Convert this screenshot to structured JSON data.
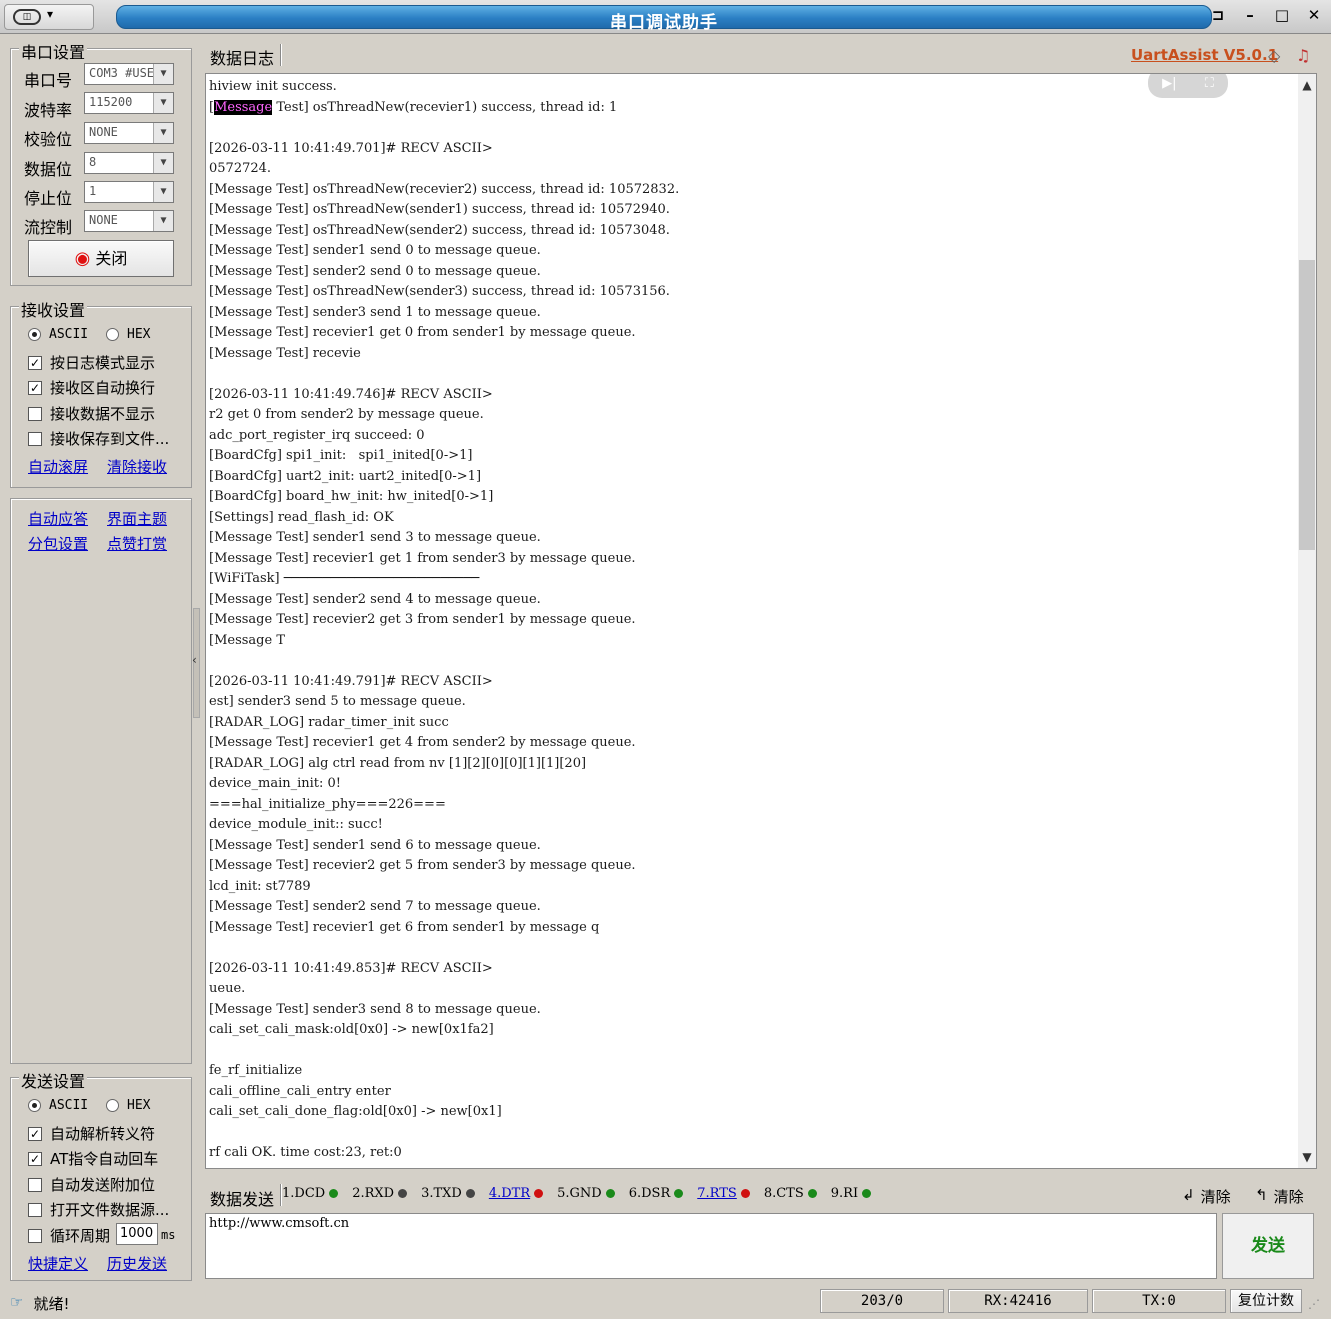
{
  "window": {
    "title": "串口调试助手"
  },
  "serial": {
    "title": "串口设置",
    "fields": [
      {
        "label": "串口号",
        "value": "COM3 #USE"
      },
      {
        "label": "波特率",
        "value": "115200"
      },
      {
        "label": "校验位",
        "value": "NONE"
      },
      {
        "label": "数据位",
        "value": "8"
      },
      {
        "label": "停止位",
        "value": "1"
      },
      {
        "label": "流控制",
        "value": "NONE"
      }
    ],
    "toggle_label": "关闭"
  },
  "recv_settings": {
    "title": "接收设置",
    "ascii": "ASCII",
    "hex": "HEX",
    "options": [
      {
        "label": "按日志模式显示",
        "checked": true
      },
      {
        "label": "接收区自动换行",
        "checked": true
      },
      {
        "label": "接收数据不显示",
        "checked": false
      },
      {
        "label": "接收保存到文件...",
        "checked": false
      }
    ],
    "link_autoscroll": "自动滚屏",
    "link_clear": "清除接收"
  },
  "misc_links": {
    "auto_reply": "自动应答",
    "theme": "界面主题",
    "packet": "分包设置",
    "reward": "点赞打赏"
  },
  "send_settings": {
    "title": "发送设置",
    "ascii": "ASCII",
    "hex": "HEX",
    "options": [
      {
        "label": "自动解析转义符",
        "checked": true
      },
      {
        "label": "AT指令自动回车",
        "checked": true
      },
      {
        "label": "自动发送附加位",
        "checked": false
      },
      {
        "label": "打开文件数据源...",
        "checked": false
      }
    ],
    "loop_label": "循环周期",
    "loop_value": "1000",
    "loop_unit": "ms",
    "link_shortcut": "快捷定义",
    "link_history": "历史发送"
  },
  "log": {
    "tab": "数据日志",
    "brand": "UartAssist V5.0.1",
    "lines": [
      "hiview init success.",
      "[Message Test] osThreadNew(recevier1) success, thread id: 1",
      "",
      "[2026-03-11 10:41:49.701]# RECV ASCII>",
      "0572724.",
      "[Message Test] osThreadNew(recevier2) success, thread id: 10572832.",
      "[Message Test] osThreadNew(sender1) success, thread id: 10572940.",
      "[Message Test] osThreadNew(sender2) success, thread id: 10573048.",
      "[Message Test] sender1 send 0 to message queue.",
      "[Message Test] sender2 send 0 to message queue.",
      "[Message Test] osThreadNew(sender3) success, thread id: 10573156.",
      "[Message Test] sender3 send 1 to message queue.",
      "[Message Test] recevier1 get 0 from sender1 by message queue.",
      "[Message Test] recevie",
      "",
      "[2026-03-11 10:41:49.746]# RECV ASCII>",
      "r2 get 0 from sender2 by message queue.",
      "adc_port_register_irq succeed: 0",
      "[BoardCfg] spi1_init:   spi1_inited[0->1]",
      "[BoardCfg] uart2_init: uart2_inited[0->1]",
      "[BoardCfg] board_hw_init: hw_inited[0->1]",
      "[Settings] read_flash_id: OK",
      "[Message Test] sender1 send 3 to message queue.",
      "[Message Test] recevier1 get 1 from sender3 by message queue.",
      "[WiFiTask] ─────────────────────────",
      "[Message Test] sender2 send 4 to message queue.",
      "[Message Test] recevier2 get 3 from sender1 by message queue.",
      "[Message T",
      "",
      "[2026-03-11 10:41:49.791]# RECV ASCII>",
      "est] sender3 send 5 to message queue.",
      "[RADAR_LOG] radar_timer_init succ",
      "[Message Test] recevier1 get 4 from sender2 by message queue.",
      "[RADAR_LOG] alg ctrl read from nv [1][2][0][0][1][1][20]",
      "device_main_init: 0!",
      "===hal_initialize_phy===226===",
      "device_module_init:: succ!",
      "[Message Test] sender1 send 6 to message queue.",
      "[Message Test] recevier2 get 5 from sender3 by message queue.",
      "lcd_init: st7789",
      "[Message Test] sender2 send 7 to message queue.",
      "[Message Test] recevier1 get 6 from sender1 by message q",
      "",
      "[2026-03-11 10:41:49.853]# RECV ASCII>",
      "ueue.",
      "[Message Test] sender3 send 8 to message queue.",
      "cali_set_cali_mask:old[0x0] -> new[0x1fa2]",
      "",
      "fe_rf_initialize",
      "cali_offline_cali_entry enter",
      "cali_set_cali_done_flag:old[0x0] -> new[0x1]",
      "",
      "rf cali OK. time cost:23, ret:0"
    ]
  },
  "send": {
    "tab": "数据发送",
    "signals": [
      {
        "label": "1.DCD",
        "color": "#1a8a1a",
        "link": false
      },
      {
        "label": "2.RXD",
        "color": "#444444",
        "link": false
      },
      {
        "label": "3.TXD",
        "color": "#444444",
        "link": false
      },
      {
        "label": "4.DTR",
        "color": "#d01010",
        "link": true
      },
      {
        "label": "5.GND",
        "color": "#1a8a1a",
        "link": false
      },
      {
        "label": "6.DSR",
        "color": "#1a8a1a",
        "link": false
      },
      {
        "label": "7.RTS",
        "color": "#d01010",
        "link": true
      },
      {
        "label": "8.CTS",
        "color": "#1a8a1a",
        "link": false
      },
      {
        "label": "9.RI",
        "color": "#1a8a1a",
        "link": false
      }
    ],
    "clear1": "清除",
    "clear2": "清除",
    "input_value": "http://www.cmsoft.cn",
    "send_label": "发送"
  },
  "status": {
    "ready": "就绪!",
    "count": "203/0",
    "rx": "RX:42416",
    "tx": "TX:0",
    "reset": "复位计数"
  },
  "colors": {
    "title_blue": "#2b7fc4",
    "brand": "#c8501e",
    "link": "#0000c8",
    "send_green": "#1a8a1a"
  }
}
